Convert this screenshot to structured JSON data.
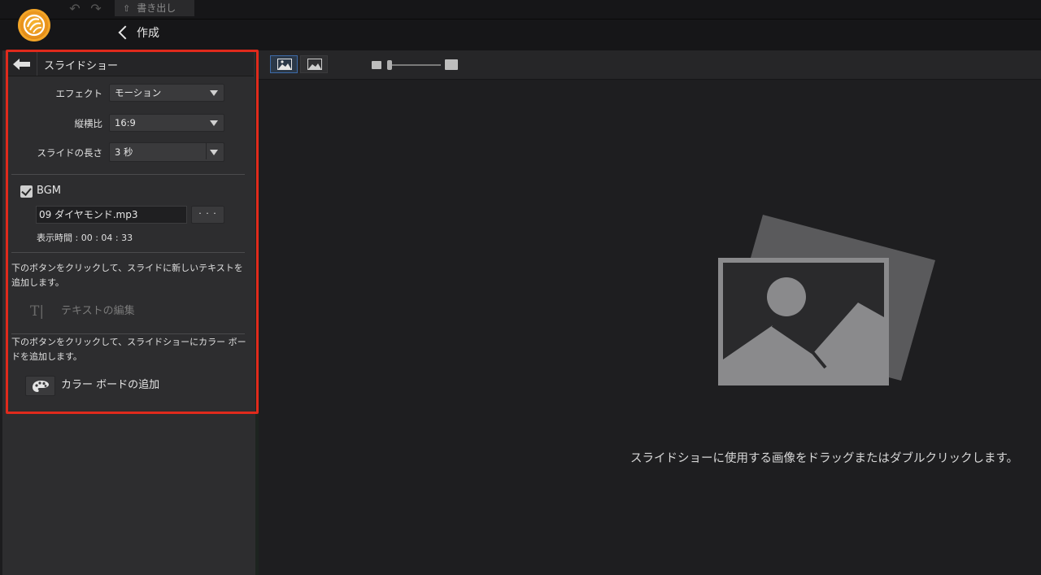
{
  "toolbar": {
    "undo_icon": "undo-arrow-icon",
    "redo_icon": "redo-arrow-icon",
    "export_label": "書き出し",
    "export_icon": "upload-icon"
  },
  "header": {
    "back_label": "作成"
  },
  "panel": {
    "title": "スライドショー",
    "effect": {
      "label": "エフェクト",
      "value": "モーション"
    },
    "aspect": {
      "label": "縦横比",
      "value": "16:9"
    },
    "duration": {
      "label": "スライドの長さ",
      "value": "3 秒"
    },
    "bgm": {
      "label": "BGM",
      "checked": true,
      "file": "09 ダイヤモンド.mp3",
      "browse_label": "· · ·",
      "display_time": "表示時間 : 00 : 04 : 33"
    },
    "text_help": "下のボタンをクリックして、スライドに新しいテキストを追加します。",
    "text_edit_label": "テキストの編集",
    "color_help": "下のボタンをクリックして、スライドショーにカラー ボードを追加します。",
    "color_add_label": "カラー ボードの追加"
  },
  "main": {
    "drop_hint": "スライドショーに使用する画像をドラッグまたはダブルクリックします。"
  },
  "colors": {
    "highlight": "#e02a1c",
    "accent_blue": "#3d6aa8",
    "logo_orange": "#f2a528"
  }
}
